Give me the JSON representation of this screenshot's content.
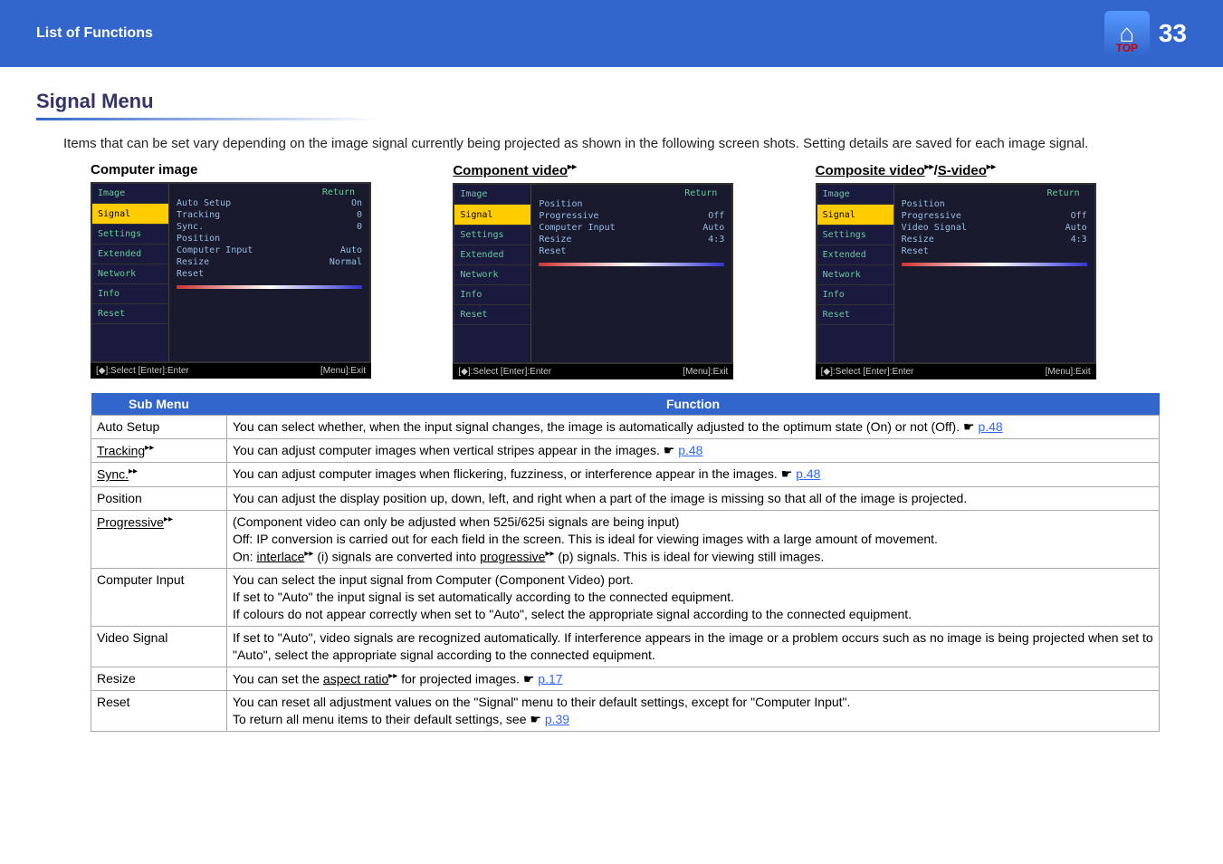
{
  "header": {
    "title": "List of Functions",
    "page_number": "33",
    "top_label": "TOP"
  },
  "section": {
    "title": "Signal Menu"
  },
  "intro": "Items that can be set vary depending on the image signal currently being projected as shown in the following screen shots. Setting details are saved for each image signal.",
  "screenshots": {
    "computer": {
      "label": "Computer image",
      "menu_items": [
        "Image",
        "Signal",
        "Settings",
        "Extended",
        "Network",
        "Info",
        "Reset"
      ],
      "return": "Return",
      "options": [
        {
          "name": "Auto Setup",
          "val": "On"
        },
        {
          "name": "Tracking",
          "val": "0"
        },
        {
          "name": "Sync.",
          "val": "0"
        },
        {
          "name": "Position",
          "val": ""
        },
        {
          "name": "Computer Input",
          "val": "Auto"
        },
        {
          "name": "Resize",
          "val": "Normal"
        },
        {
          "name": "Reset",
          "val": ""
        }
      ],
      "footer_left": "[◆]:Select [Enter]:Enter",
      "footer_right": "[Menu]:Exit"
    },
    "component": {
      "label_prefix": "Component video",
      "menu_items": [
        "Image",
        "Signal",
        "Settings",
        "Extended",
        "Network",
        "Info",
        "Reset"
      ],
      "return": "Return",
      "options": [
        {
          "name": "Position",
          "val": ""
        },
        {
          "name": "Progressive",
          "val": "Off"
        },
        {
          "name": "Computer Input",
          "val": "Auto"
        },
        {
          "name": "Resize",
          "val": "4:3"
        },
        {
          "name": "Reset",
          "val": ""
        }
      ],
      "footer_left": "[◆]:Select [Enter]:Enter",
      "footer_right": "[Menu]:Exit"
    },
    "composite": {
      "label_a": "Composite video",
      "label_sep": "/",
      "label_b": "S-video",
      "menu_items": [
        "Image",
        "Signal",
        "Settings",
        "Extended",
        "Network",
        "Info",
        "Reset"
      ],
      "return": "Return",
      "options": [
        {
          "name": "Position",
          "val": ""
        },
        {
          "name": "Progressive",
          "val": "Off"
        },
        {
          "name": "Video Signal",
          "val": "Auto"
        },
        {
          "name": "Resize",
          "val": "4:3"
        },
        {
          "name": "Reset",
          "val": ""
        }
      ],
      "footer_left": "[◆]:Select [Enter]:Enter",
      "footer_right": "[Menu]:Exit"
    }
  },
  "table": {
    "headers": [
      "Sub Menu",
      "Function"
    ],
    "rows": [
      {
        "sub": "Auto Setup",
        "glossary": false,
        "func": "You can select whether, when the input signal changes, the image is automatically adjusted to the optimum state (On) or not (Off). ",
        "link": "p.48"
      },
      {
        "sub": "Tracking",
        "glossary": true,
        "func": "You can adjust computer images when vertical stripes appear in the images. ",
        "link": "p.48"
      },
      {
        "sub": "Sync.",
        "glossary": true,
        "func": "You can adjust computer images when flickering, fuzziness, or interference appear in the images. ",
        "link": "p.48"
      },
      {
        "sub": "Position",
        "glossary": false,
        "func": "You can adjust the display position up, down, left, and right when a part of the image is missing so that all of the image is projected.",
        "link": ""
      },
      {
        "sub": "Progressive",
        "glossary": true,
        "func_lines": [
          "(Component video can only be adjusted when 525i/625i signals are being input)",
          "Off: IP conversion is carried out for each field in the screen. This is ideal for viewing images with a large amount of movement."
        ],
        "func_line3_pre": "On: ",
        "func_line3_term1": "interlace",
        "func_line3_mid": " (i) signals are converted into ",
        "func_line3_term2": "progressive",
        "func_line3_post": " (p) signals. This is ideal for viewing still images.",
        "link": ""
      },
      {
        "sub": "Computer Input",
        "glossary": false,
        "func_lines": [
          "You can select the input signal from Computer (Component Video) port.",
          "If set to \"Auto\" the input signal is set automatically according to the connected equipment.",
          "If colours do not appear correctly when set to \"Auto\", select the appropriate signal according to the connected equipment."
        ],
        "link": ""
      },
      {
        "sub": "Video Signal",
        "glossary": false,
        "func_lines": [
          "If set to \"Auto\", video signals are recognized automatically. If interference appears in the image or a problem occurs such as no image is being projected when set to \"Auto\", select the appropriate signal according to the connected equipment."
        ],
        "link": ""
      },
      {
        "sub": "Resize",
        "glossary": false,
        "func_pre": "You can set the ",
        "func_term": "aspect ratio",
        "func_post": " for projected images. ",
        "link": "p.17"
      },
      {
        "sub": "Reset",
        "glossary": false,
        "func_lines": [
          "You can reset all adjustment values on the \"Signal\" menu to their default settings, except for \"Computer Input\"."
        ],
        "func_line2_pre": "To return all menu items to their default settings, see ",
        "link": "p.39"
      }
    ]
  }
}
